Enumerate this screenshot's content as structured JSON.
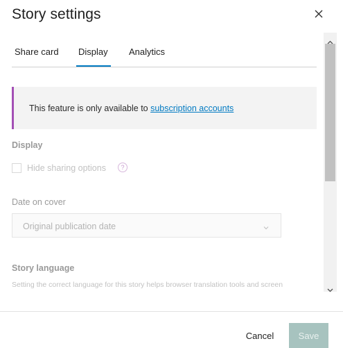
{
  "dialog": {
    "title": "Story settings",
    "close_icon": "close-icon"
  },
  "tabs": [
    {
      "label": "Share card",
      "active": false
    },
    {
      "label": "Display",
      "active": true
    },
    {
      "label": "Analytics",
      "active": false
    }
  ],
  "notice": {
    "text": "This feature is only available to ",
    "link": "subscription accounts",
    "accent_color": "#a34fb5"
  },
  "display_section": {
    "title": "Display",
    "checkbox_label": "Hide sharing options",
    "checked": false,
    "help_icon": "question-icon"
  },
  "date_field": {
    "label": "Date on cover",
    "value": "Original publication date",
    "chevron_icon": "chevron-down-icon"
  },
  "language_section": {
    "title": "Story language",
    "description": "Setting the correct language for this story helps browser translation tools and screen"
  },
  "footer": {
    "cancel_label": "Cancel",
    "save_label": "Save",
    "save_color": "#a7c3bf"
  },
  "colors": {
    "accent": "#007ac2"
  }
}
